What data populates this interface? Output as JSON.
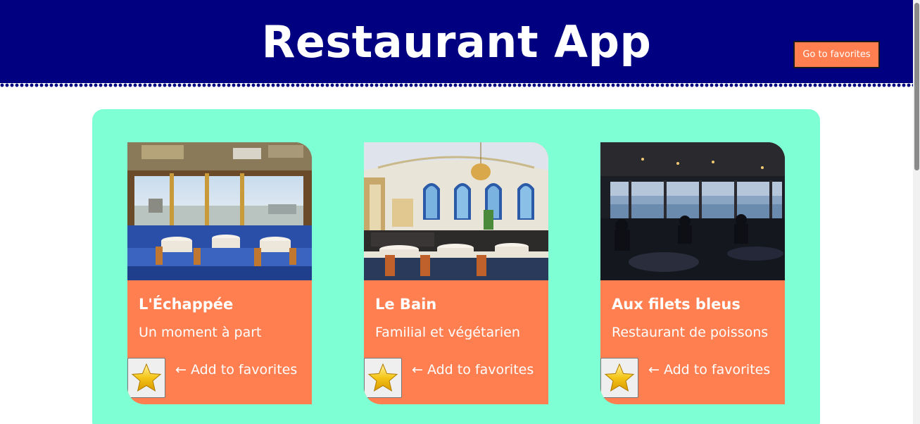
{
  "header": {
    "title": "Restaurant App",
    "favorites_button": "Go to favorites"
  },
  "restaurants": [
    {
      "name": "L'Échappée",
      "description": "Un moment à part",
      "add_label": "← Add to favorites",
      "image": "ornate dining room with mirrored ceiling and blue carpet"
    },
    {
      "name": "Le Bain",
      "description": "Familial et végétarien",
      "add_label": "← Add to favorites",
      "image": "bright dining room with arched windows and chandelier"
    },
    {
      "name": "Aux filets bleus",
      "description": "Restaurant de poissons",
      "add_label": "← Add to favorites",
      "image": "dim dining room overlooking the sea"
    }
  ],
  "icons": {
    "favorite": "star-icon"
  },
  "colors": {
    "header": "#000080",
    "accent": "#ff7f50",
    "panel": "#7fffd4"
  }
}
